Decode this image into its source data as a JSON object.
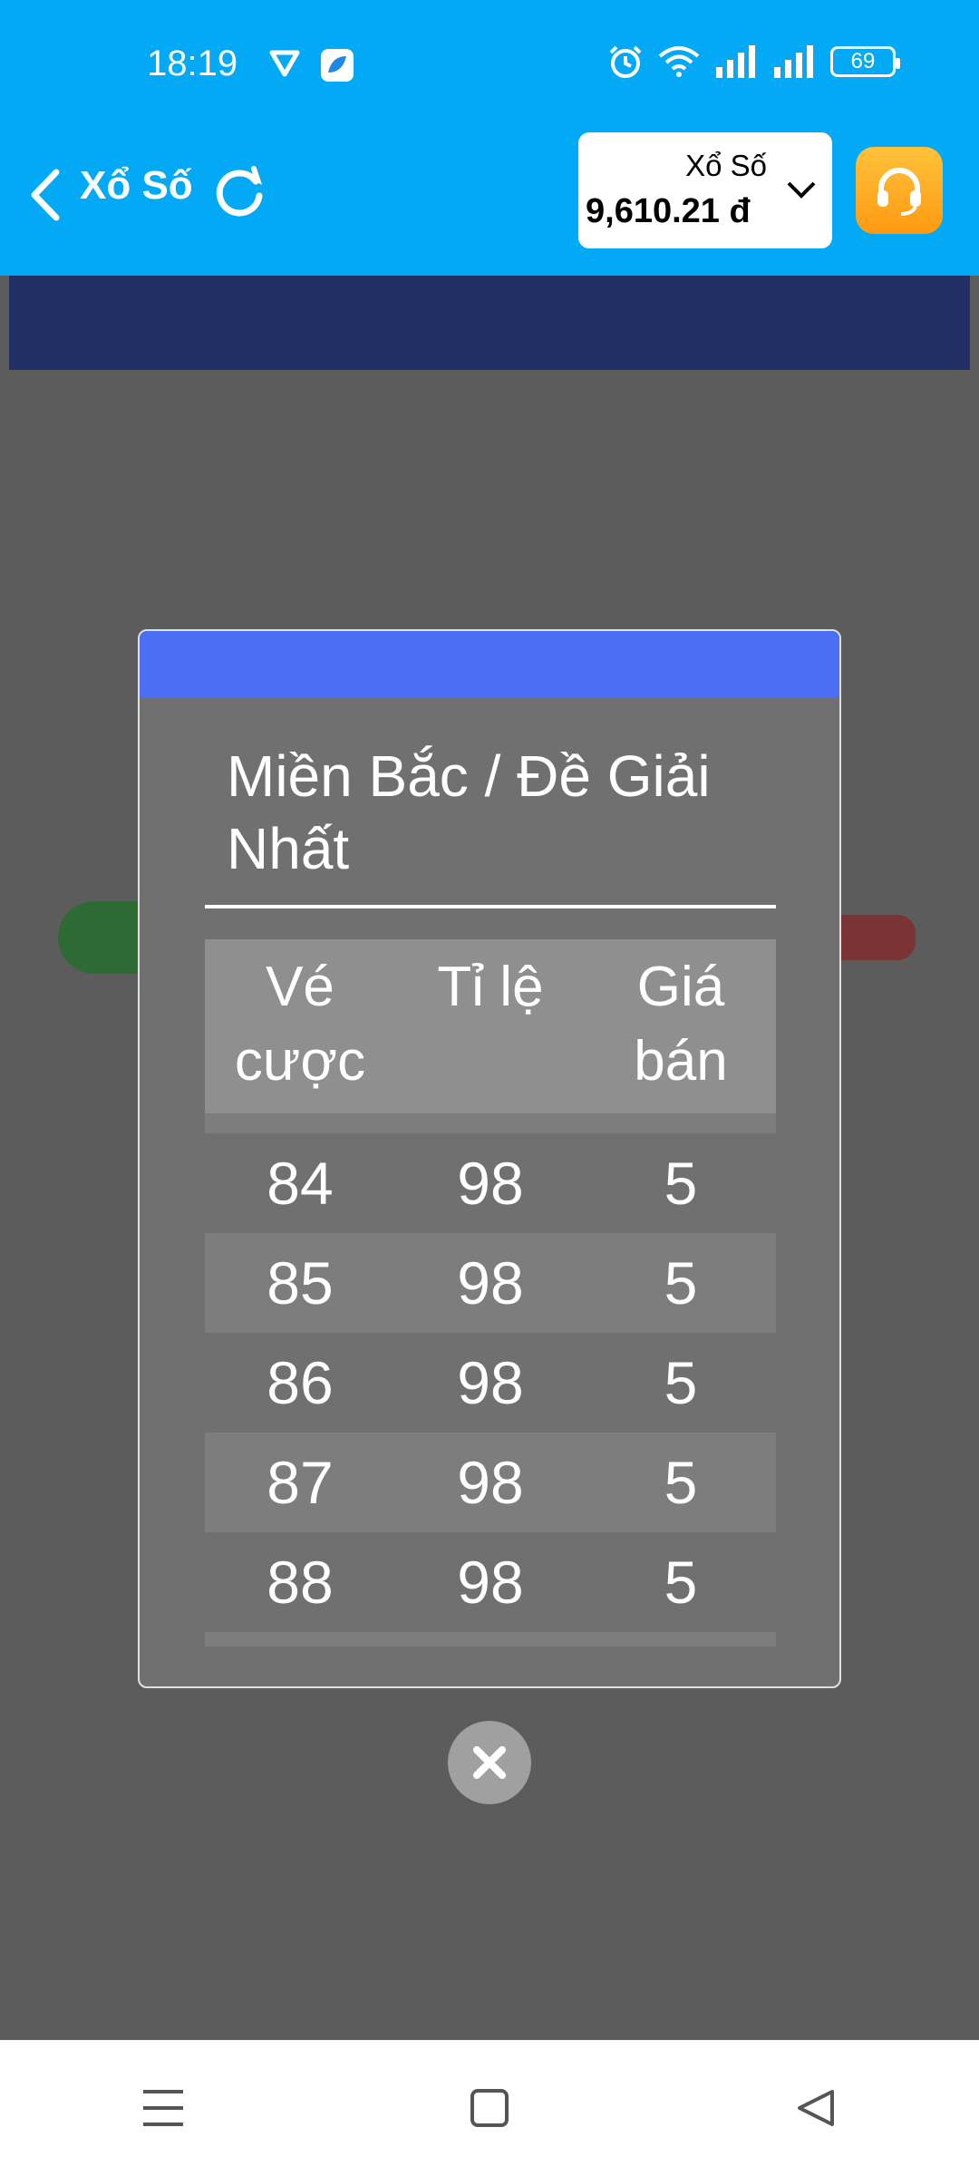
{
  "status_bar": {
    "time": "18:19",
    "battery": "69",
    "icons": [
      "vpn-shield-icon",
      "app-icon",
      "alarm-icon",
      "wifi-icon",
      "signal-icon",
      "signal-icon",
      "battery-icon"
    ]
  },
  "header": {
    "title": "Xổ Số",
    "wallet_label": "Xổ Số",
    "wallet_amount": "9,610.21 đ"
  },
  "modal": {
    "title": "Miền Bắc / Đề Giải Nhất",
    "columns": [
      "Vé cược",
      "Tỉ lệ",
      "Giá bán"
    ],
    "rows": [
      [
        "84",
        "98",
        "5"
      ],
      [
        "85",
        "98",
        "5"
      ],
      [
        "86",
        "98",
        "5"
      ],
      [
        "87",
        "98",
        "5"
      ],
      [
        "88",
        "98",
        "5"
      ]
    ]
  },
  "colors": {
    "header_bg": "#03a9f4",
    "modal_topbar": "#4c6ef5",
    "support_btn": "#ff9a12"
  }
}
